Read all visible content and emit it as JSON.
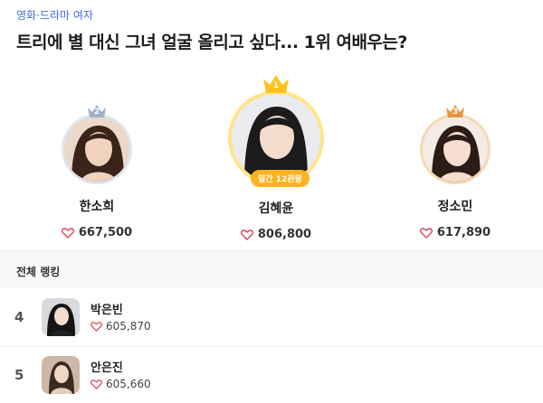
{
  "header": {
    "category": "영화·드라마 여자",
    "title": "트리에 별 대신 그녀 얼굴 올리고 싶다... 1위 여배우는?"
  },
  "podium": [
    {
      "rank": "2",
      "name": "한소희",
      "likes": "667,500",
      "crown_color": "#9fb0c4",
      "ring_color": "#dfe5ec"
    },
    {
      "rank": "1",
      "name": "김혜윤",
      "likes": "806,800",
      "crown_color": "#ffc21a",
      "ring_color": "#ffe48a",
      "badge": "일간 12관왕"
    },
    {
      "rank": "3",
      "name": "정소민",
      "likes": "617,890",
      "crown_color": "#e8953a",
      "ring_color": "#f6d8b4"
    }
  ],
  "section": {
    "title": "전체 랭킹"
  },
  "ranking": [
    {
      "rank": "4",
      "name": "박은빈",
      "likes": "605,870"
    },
    {
      "rank": "5",
      "name": "안은진",
      "likes": "605,660"
    }
  ],
  "colors": {
    "accent": "#3f6fe0",
    "heart": "#e0445a",
    "badge": "#ffb21f"
  }
}
